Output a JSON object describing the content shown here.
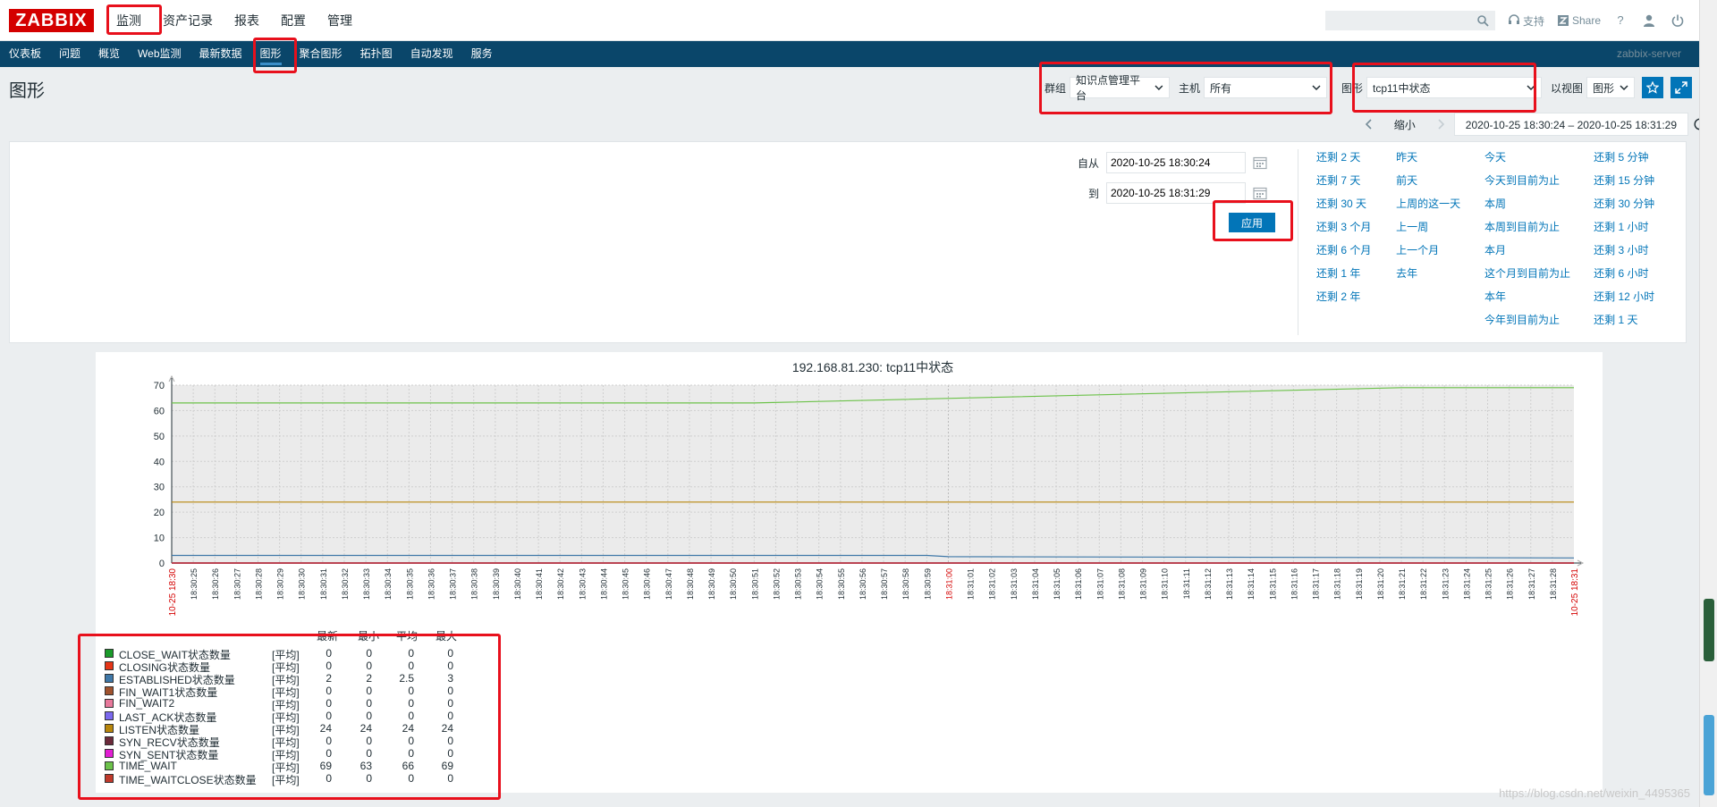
{
  "logo": "ZABBIX",
  "topnav": [
    "监测",
    "资产记录",
    "报表",
    "配置",
    "管理"
  ],
  "topright": {
    "search_placeholder": "",
    "support": "支持",
    "share": "Share",
    "help": "?"
  },
  "subnav": {
    "items": [
      "仪表板",
      "问题",
      "概览",
      "Web监测",
      "最新数据",
      "图形",
      "聚合图形",
      "拓扑图",
      "自动发现",
      "服务"
    ],
    "active_index": 5,
    "server": "zabbix-server"
  },
  "page_title": "图形",
  "filters": {
    "group_label": "群组",
    "group_value": "知识点管理平台",
    "host_label": "主机",
    "host_value": "所有",
    "graph_label": "图形",
    "graph_value": "tcp11中状态",
    "view_label": "以视图",
    "view_value": "图形"
  },
  "timenav": {
    "zoom": "缩小",
    "range": "2020-10-25 18:30:24 – 2020-10-25 18:31:29"
  },
  "timeform": {
    "from_label": "自从",
    "from_value": "2020-10-25 18:30:24",
    "to_label": "到",
    "to_value": "2020-10-25 18:31:29",
    "apply": "应用"
  },
  "quick_ranges": [
    [
      "还剩 2 天",
      "还剩 7 天",
      "还剩 30 天",
      "还剩 3 个月",
      "还剩 6 个月",
      "还剩 1 年",
      "还剩 2 年"
    ],
    [
      "昨天",
      "前天",
      "上周的这一天",
      "上一周",
      "上一个月",
      "去年"
    ],
    [
      "今天",
      "今天到目前为止",
      "本周",
      "本周到目前为止",
      "本月",
      "这个月到目前为止",
      "本年",
      "今年到目前为止"
    ],
    [
      "还剩 5 分钟",
      "还剩 15 分钟",
      "还剩 30 分钟",
      "还剩 1 小时",
      "还剩 3 小时",
      "还剩 6 小时",
      "还剩 12 小时",
      "还剩 1 天"
    ]
  ],
  "chart_data": {
    "type": "line",
    "title": "192.168.81.230: tcp11中状态",
    "ylim": [
      0,
      70
    ],
    "yticks": [
      0,
      10,
      20,
      30,
      40,
      50,
      60,
      70
    ],
    "x_start_label": "10-25 18:30",
    "x_end_label": "10-25 18:31",
    "x_mid_label": "18:31:00",
    "x_tick_labels": [
      "18:30:25",
      "18:30:26",
      "18:30:27",
      "18:30:28",
      "18:30:29",
      "18:30:30",
      "18:30:31",
      "18:30:32",
      "18:30:33",
      "18:30:34",
      "18:30:35",
      "18:30:36",
      "18:30:37",
      "18:30:38",
      "18:30:39",
      "18:30:40",
      "18:30:41",
      "18:30:42",
      "18:30:43",
      "18:30:44",
      "18:30:45",
      "18:30:46",
      "18:30:47",
      "18:30:48",
      "18:30:49",
      "18:30:50",
      "18:30:51",
      "18:30:52",
      "18:30:53",
      "18:30:54",
      "18:30:55",
      "18:30:56",
      "18:30:57",
      "18:30:58",
      "18:30:59",
      "18:31:00",
      "18:31:01",
      "18:31:02",
      "18:31:03",
      "18:31:04",
      "18:31:05",
      "18:31:06",
      "18:31:07",
      "18:31:08",
      "18:31:09",
      "18:31:10",
      "18:31:11",
      "18:31:12",
      "18:31:13",
      "18:31:14",
      "18:31:15",
      "18:31:16",
      "18:31:17",
      "18:31:18",
      "18:31:19",
      "18:31:20",
      "18:31:21",
      "18:31:22",
      "18:31:23",
      "18:31:24",
      "18:31:25",
      "18:31:26",
      "18:31:27",
      "18:31:28"
    ],
    "x_range_seconds": [
      0,
      65
    ],
    "legend_header": [
      "最新",
      "最小",
      "平均",
      "最大"
    ],
    "series": [
      {
        "name": "CLOSE_WAIT状态数量",
        "fn": "[平均]",
        "color": "#1a9a2a",
        "last": "0",
        "min": "0",
        "avg": "0",
        "max": "0",
        "points": [
          [
            0,
            0
          ],
          [
            65,
            0
          ]
        ]
      },
      {
        "name": "CLOSING状态数量",
        "fn": "[平均]",
        "color": "#e53517",
        "last": "0",
        "min": "0",
        "avg": "0",
        "max": "0",
        "points": [
          [
            0,
            0
          ],
          [
            65,
            0
          ]
        ]
      },
      {
        "name": "ESTABLISHED状态数量",
        "fn": "[平均]",
        "color": "#3f78a8",
        "last": "2",
        "min": "2",
        "avg": "2.5",
        "max": "3",
        "points": [
          [
            0,
            3
          ],
          [
            35,
            3
          ],
          [
            36,
            2.5
          ],
          [
            65,
            2
          ]
        ]
      },
      {
        "name": "FIN_WAIT1状态数量",
        "fn": "[平均]",
        "color": "#a0522d",
        "last": "0",
        "min": "0",
        "avg": "0",
        "max": "0",
        "points": [
          [
            0,
            0
          ],
          [
            65,
            0
          ]
        ]
      },
      {
        "name": "FIN_WAIT2",
        "fn": "[平均]",
        "color": "#e8799b",
        "last": "0",
        "min": "0",
        "avg": "0",
        "max": "0",
        "points": [
          [
            0,
            0
          ],
          [
            65,
            0
          ]
        ]
      },
      {
        "name": "LAST_ACK状态数量",
        "fn": "[平均]",
        "color": "#7b68ee",
        "last": "0",
        "min": "0",
        "avg": "0",
        "max": "0",
        "points": [
          [
            0,
            0
          ],
          [
            65,
            0
          ]
        ]
      },
      {
        "name": "LISTEN状态数量",
        "fn": "[平均]",
        "color": "#b8860b",
        "last": "24",
        "min": "24",
        "avg": "24",
        "max": "24",
        "points": [
          [
            0,
            24
          ],
          [
            65,
            24
          ]
        ]
      },
      {
        "name": "SYN_RECV状态数量",
        "fn": "[平均]",
        "color": "#6b2a3a",
        "last": "0",
        "min": "0",
        "avg": "0",
        "max": "0",
        "points": [
          [
            0,
            0
          ],
          [
            65,
            0
          ]
        ]
      },
      {
        "name": "SYN_SENT状态数量",
        "fn": "[平均]",
        "color": "#e21ed3",
        "last": "0",
        "min": "0",
        "avg": "0",
        "max": "0",
        "points": [
          [
            0,
            0
          ],
          [
            65,
            0
          ]
        ]
      },
      {
        "name": "TIME_WAIT",
        "fn": "[平均]",
        "color": "#6cc24a",
        "last": "69",
        "min": "63",
        "avg": "66",
        "max": "69",
        "points": [
          [
            0,
            63
          ],
          [
            27,
            63
          ],
          [
            57,
            69
          ],
          [
            65,
            69
          ]
        ]
      },
      {
        "name": "TIME_WAITCLOSE状态数量",
        "fn": "[平均]",
        "color": "#c0392b",
        "last": "0",
        "min": "0",
        "avg": "0",
        "max": "0",
        "points": [
          [
            0,
            0
          ],
          [
            65,
            0
          ]
        ]
      }
    ]
  },
  "watermark": "https://blog.csdn.net/weixin_4495365"
}
